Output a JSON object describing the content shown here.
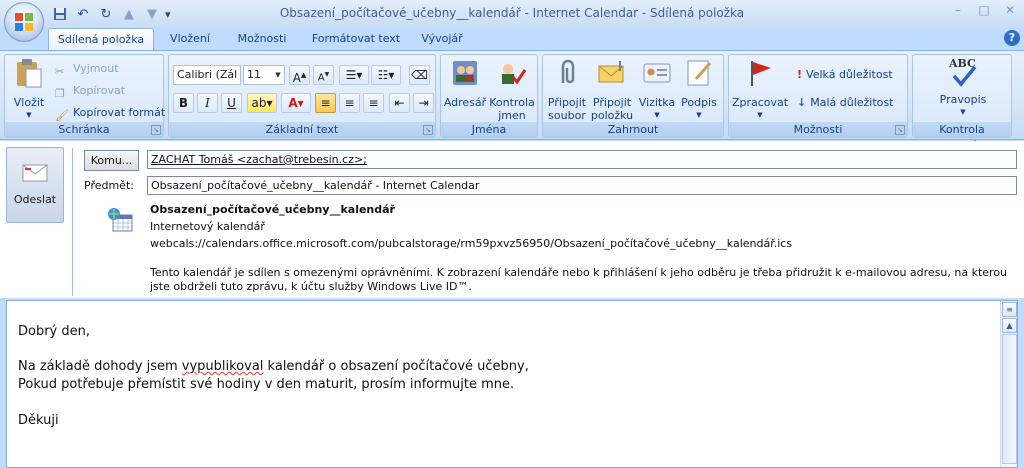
{
  "window": {
    "title": "Obsazení_počítačové_učebny__kalendář - Internet Calendar - Sdílená položka"
  },
  "tabs": [
    {
      "label": "Sdílená položka",
      "active": true
    },
    {
      "label": "Vložení"
    },
    {
      "label": "Možnosti"
    },
    {
      "label": "Formátovat text"
    },
    {
      "label": "Vývojář"
    }
  ],
  "help_label": "?",
  "ribbon": {
    "clipboard": {
      "label": "Schránka",
      "paste": "Vložit",
      "cut": "Vyjmout",
      "copy": "Kopírovat",
      "format_painter": "Kopírovat formát"
    },
    "basic_text": {
      "label": "Základní text",
      "font": "Calibri (Zál",
      "size": "11"
    },
    "names": {
      "label": "Jména",
      "address_book": "Adresář",
      "check_names": "Kontrola jmen"
    },
    "include": {
      "label": "Zahrnout",
      "attach_file": "Připojit soubor",
      "attach_item": "Připojit položku",
      "business_card": "Vizitka",
      "signature": "Podpis"
    },
    "options": {
      "label": "Možnosti",
      "follow_up": "Zpracovat",
      "high_importance": "Velká důležitost",
      "low_importance": "Malá důležitost"
    },
    "proofing": {
      "label": "Kontrola pravopisu",
      "spelling": "Pravopis",
      "icon_text": "ABC"
    }
  },
  "message": {
    "send": "Odeslat",
    "to_button": "Komu...",
    "to_value": "ZACHAT Tomáš <zachat@trebesin.cz>;",
    "subject_label": "Předmět:",
    "subject_value": "Obsazení_počítačové_učebny__kalendář - Internet Calendar",
    "attachment": {
      "name": "Obsazení_počítačové_učebny__kalendář",
      "type": "Internetový kalendář",
      "url": "webcals://calendars.office.microsoft.com/pubcalstorage/rm59pxvz56950/Obsazení_počítačové_učebny__kalendář.ics",
      "note": "Tento kalendář je sdílen s omezenými oprávněními. K zobrazení kalendáře nebo k přihlášení k jeho odběru je třeba přidružit k e-mailovou adresu, na kterou jste obdrželi tuto zprávu, k účtu služby Windows Live ID™."
    },
    "body": {
      "greeting": "Dobrý den,",
      "line1_before": "Na základě dohody jsem ",
      "line1_word": "vypublikoval",
      "line1_after": " kalendář o obsazení počítačové učebny,",
      "line2": "Pokud potřebuje přemístit své hodiny v den maturit, prosím informujte mne.",
      "closing": "Děkuji"
    }
  }
}
